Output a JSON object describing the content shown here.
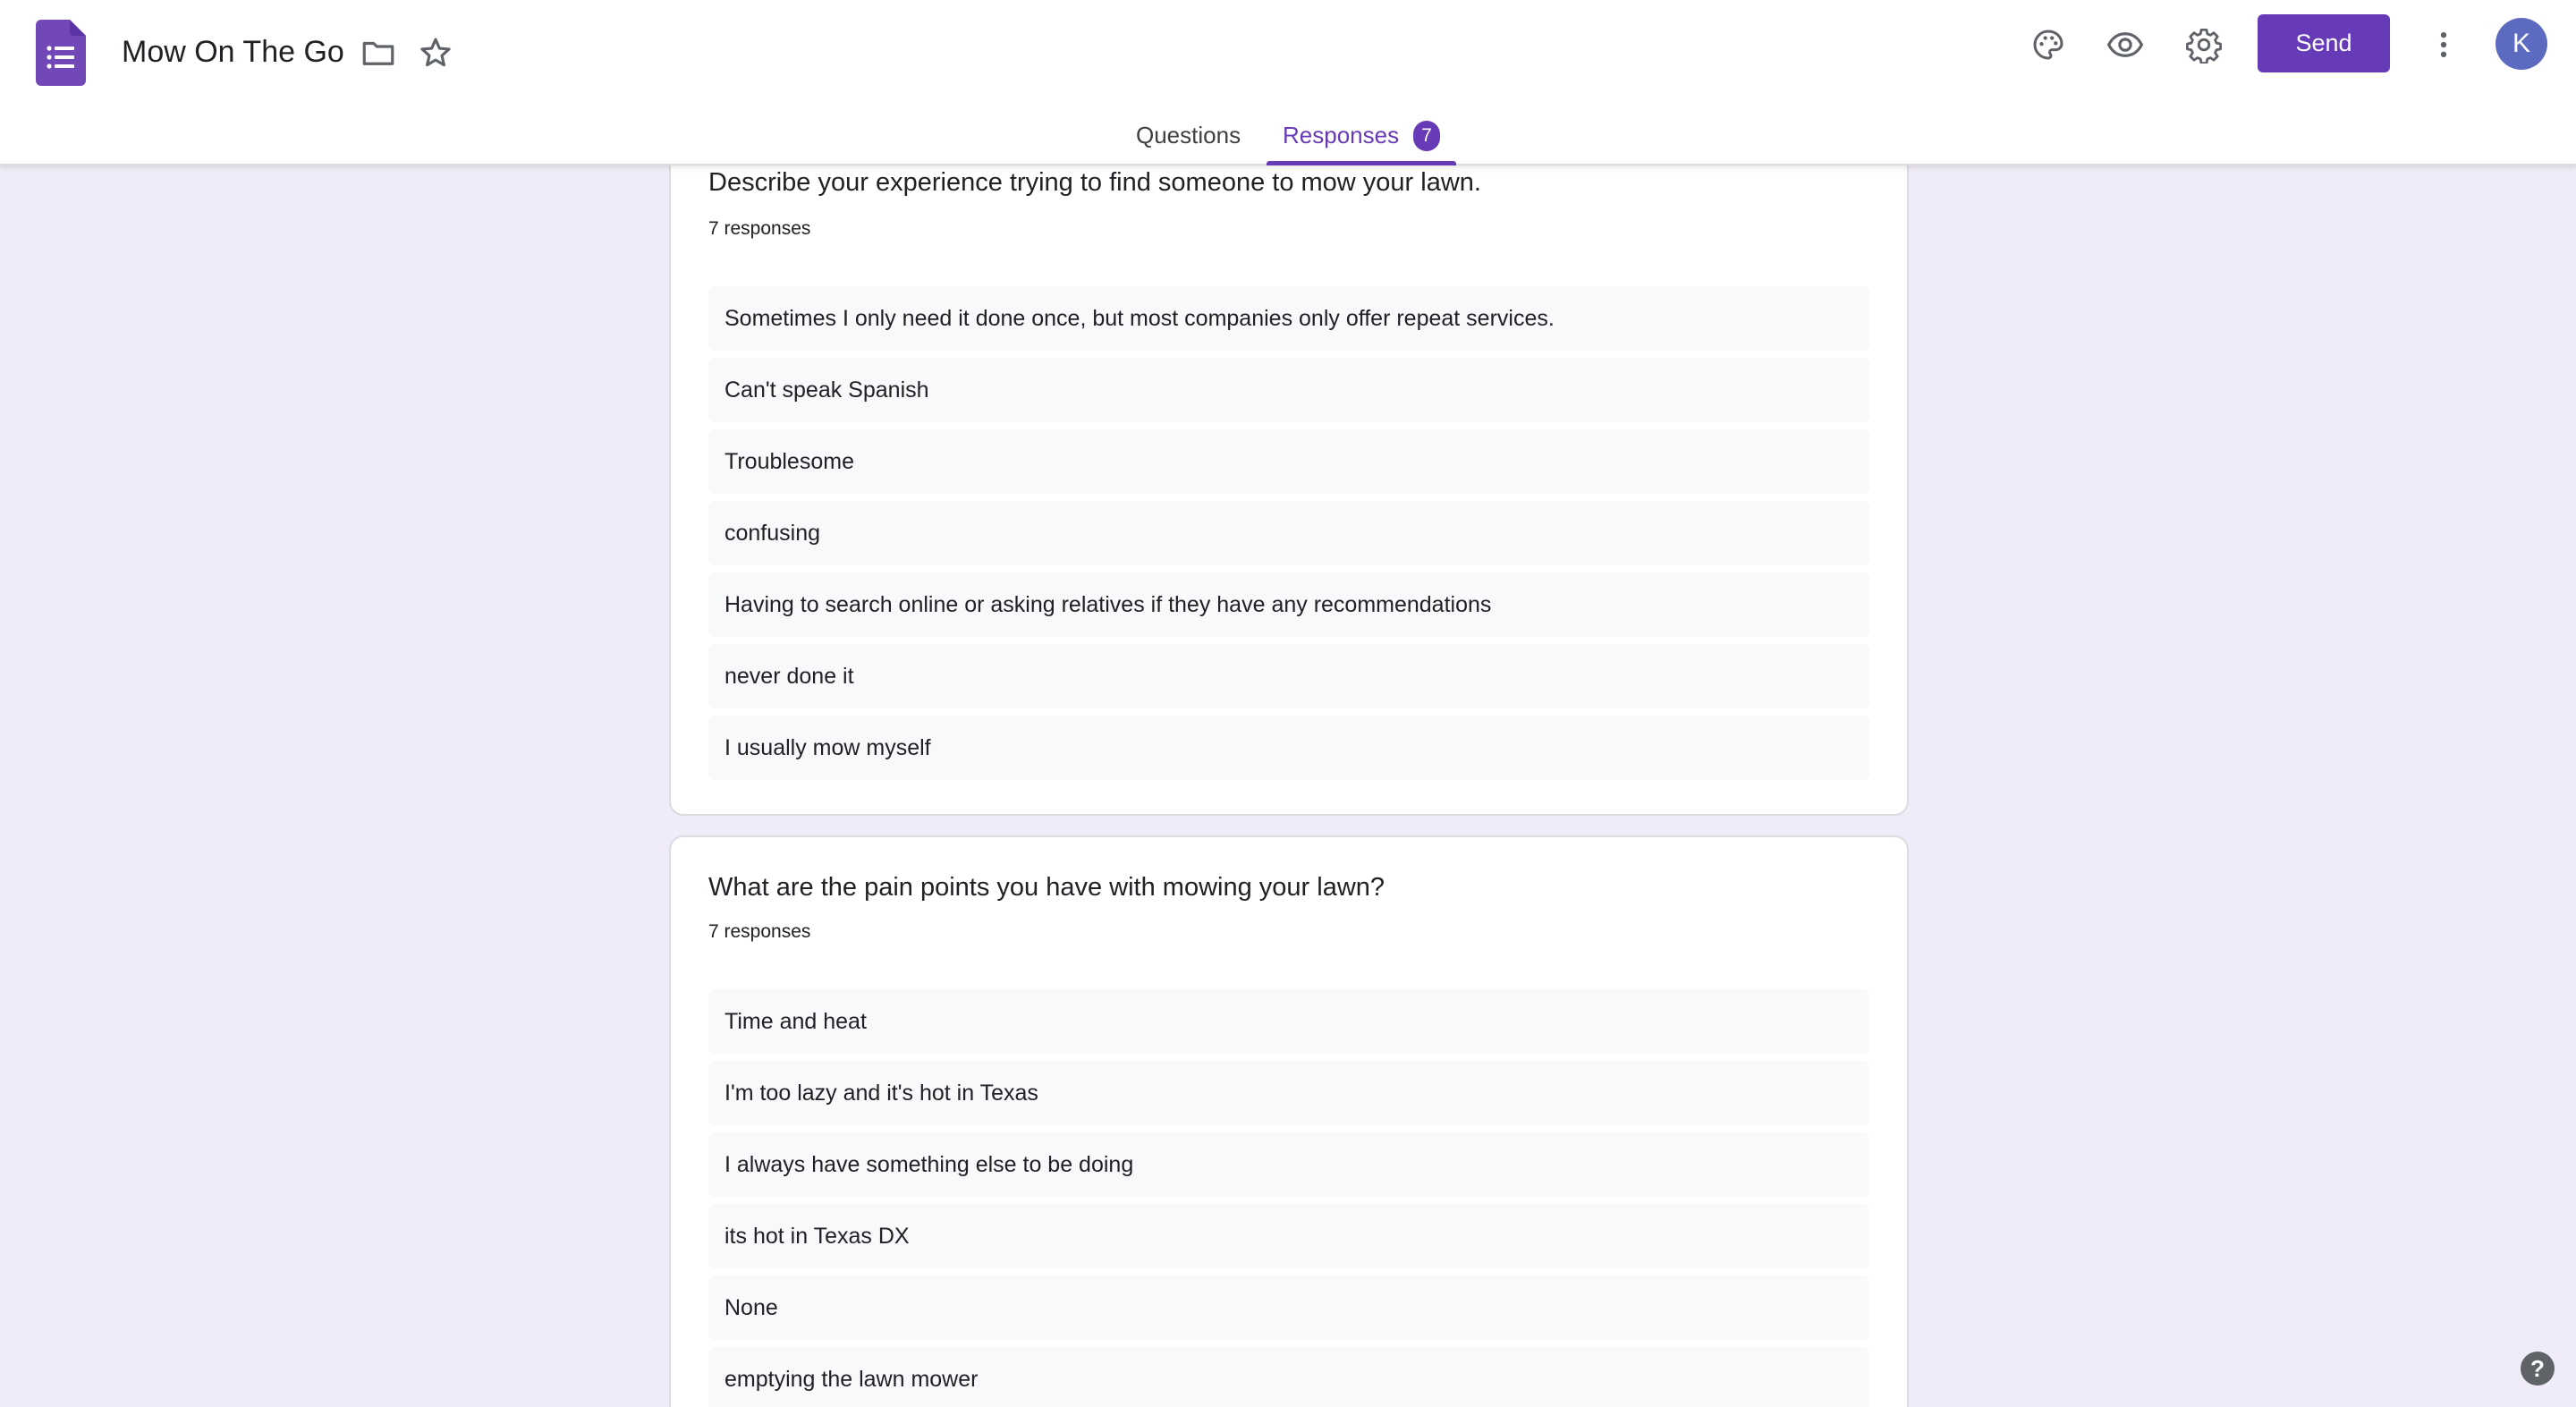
{
  "app": {
    "title": "Mow On The Go",
    "send_label": "Send",
    "avatar_letter": "K",
    "accent_color": "#673ab7"
  },
  "tabs": {
    "questions_label": "Questions",
    "responses_label": "Responses",
    "responses_count": "7"
  },
  "icons": [
    "forms-doc-icon",
    "folder-icon",
    "star-icon",
    "palette-icon",
    "eye-icon",
    "gear-icon",
    "more-vert-icon",
    "help-icon"
  ],
  "cards": [
    {
      "question": "Describe your experience trying to find someone to mow your lawn.",
      "count": "7 responses",
      "responses": [
        "Sometimes I only need it done once, but most companies only offer repeat services.",
        "Can't speak Spanish",
        "Troublesome",
        "confusing",
        "Having to search online or asking relatives if they have any recommendations",
        "never done it",
        "I usually mow myself"
      ]
    },
    {
      "question": "What are the pain points you have with mowing your lawn?",
      "count": "7 responses",
      "responses": [
        "Time and heat",
        "I'm too lazy and it's hot in Texas",
        "I always have something else to be doing",
        "its hot in Texas DX",
        "None",
        "emptying the lawn mower"
      ]
    }
  ],
  "help": {
    "label": "?"
  }
}
